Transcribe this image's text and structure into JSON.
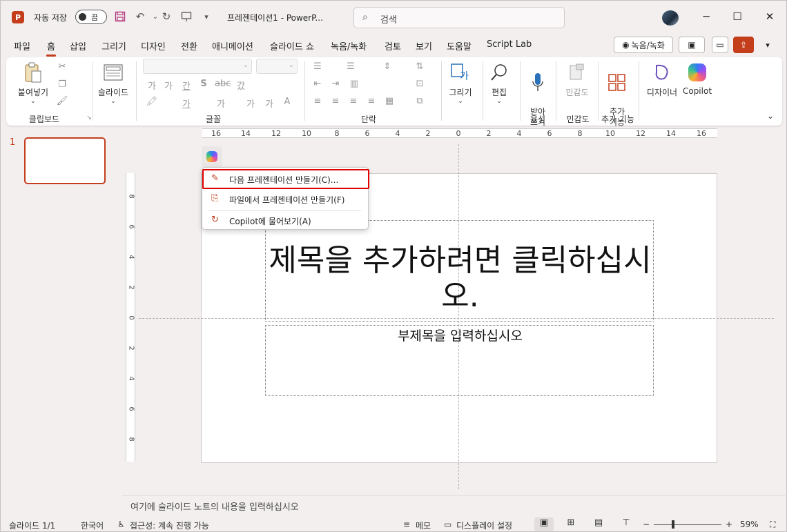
{
  "titlebar": {
    "app_logo": "P",
    "autosave_label": "자동 저장",
    "autosave_state": "끔",
    "doc_title": "프레젠테이션1  -  PowerP...",
    "search_placeholder": "검색",
    "icons": [
      "save-icon",
      "undo-icon",
      "redo-icon",
      "present-icon",
      "customize-icon"
    ],
    "window_controls": [
      "─",
      "☐",
      "✕"
    ]
  },
  "tabs": {
    "items": [
      "파일",
      "홈",
      "삽입",
      "그리기",
      "디자인",
      "전환",
      "애니메이션",
      "슬라이드 쇼",
      "녹음/녹화",
      "검토",
      "보기",
      "도움말",
      "Script Lab"
    ],
    "active": "홈",
    "record_button": "녹음/녹화"
  },
  "ribbon": {
    "clipboard": {
      "paste": "붙여넣기",
      "group": "클립보드"
    },
    "slides": {
      "new_slide": "슬라이드",
      "group": ""
    },
    "font": {
      "group": "글꼴"
    },
    "paragraph": {
      "group": "단락"
    },
    "drawing": {
      "label": "그리기"
    },
    "editing": {
      "label": "편집"
    },
    "voice": {
      "dictate": "받아\n쓰기",
      "group": "음성"
    },
    "sensitivity": {
      "label": "민감도",
      "group": "민감도"
    },
    "addins": {
      "label": "추가\n기능",
      "group": "추가 기능"
    },
    "designer": {
      "label": "디자이너"
    },
    "copilot": {
      "label": "Copilot"
    }
  },
  "thumbnails": {
    "slide_number": "1"
  },
  "rulers": {
    "horizontal": [
      "16",
      "14",
      "12",
      "10",
      "8",
      "6",
      "4",
      "2",
      "0",
      "2",
      "4",
      "6",
      "8",
      "10",
      "12",
      "14",
      "16"
    ],
    "vertical": [
      "8",
      "6",
      "4",
      "2",
      "0",
      "2",
      "4",
      "6",
      "8"
    ]
  },
  "slide": {
    "title_placeholder": "제목을 추가하려면 클릭하십시오.",
    "subtitle_placeholder": "부제목을 입력하십시오"
  },
  "copilot_menu": {
    "items": [
      {
        "label": "다음 프레젠테이션 만들기(C)...",
        "icon": "pencil-sparkle-icon"
      },
      {
        "label": "파일에서 프레젠테이션 만들기(F)",
        "icon": "file-icon"
      },
      {
        "label": "Copilot에 물어보기(A)",
        "icon": "copilot-chat-icon"
      }
    ]
  },
  "notes": {
    "placeholder": "여기에 슬라이드 노트의 내용을 입력하십시오"
  },
  "statusbar": {
    "slide_count": "슬라이드 1/1",
    "language": "한국어",
    "accessibility": "접근성: 계속 진행 가능",
    "notes_button": "메모",
    "display_settings": "디스플레이 설정",
    "zoom": "59%"
  },
  "colors": {
    "accent": "#c43e1c",
    "highlight": "#e00000"
  }
}
